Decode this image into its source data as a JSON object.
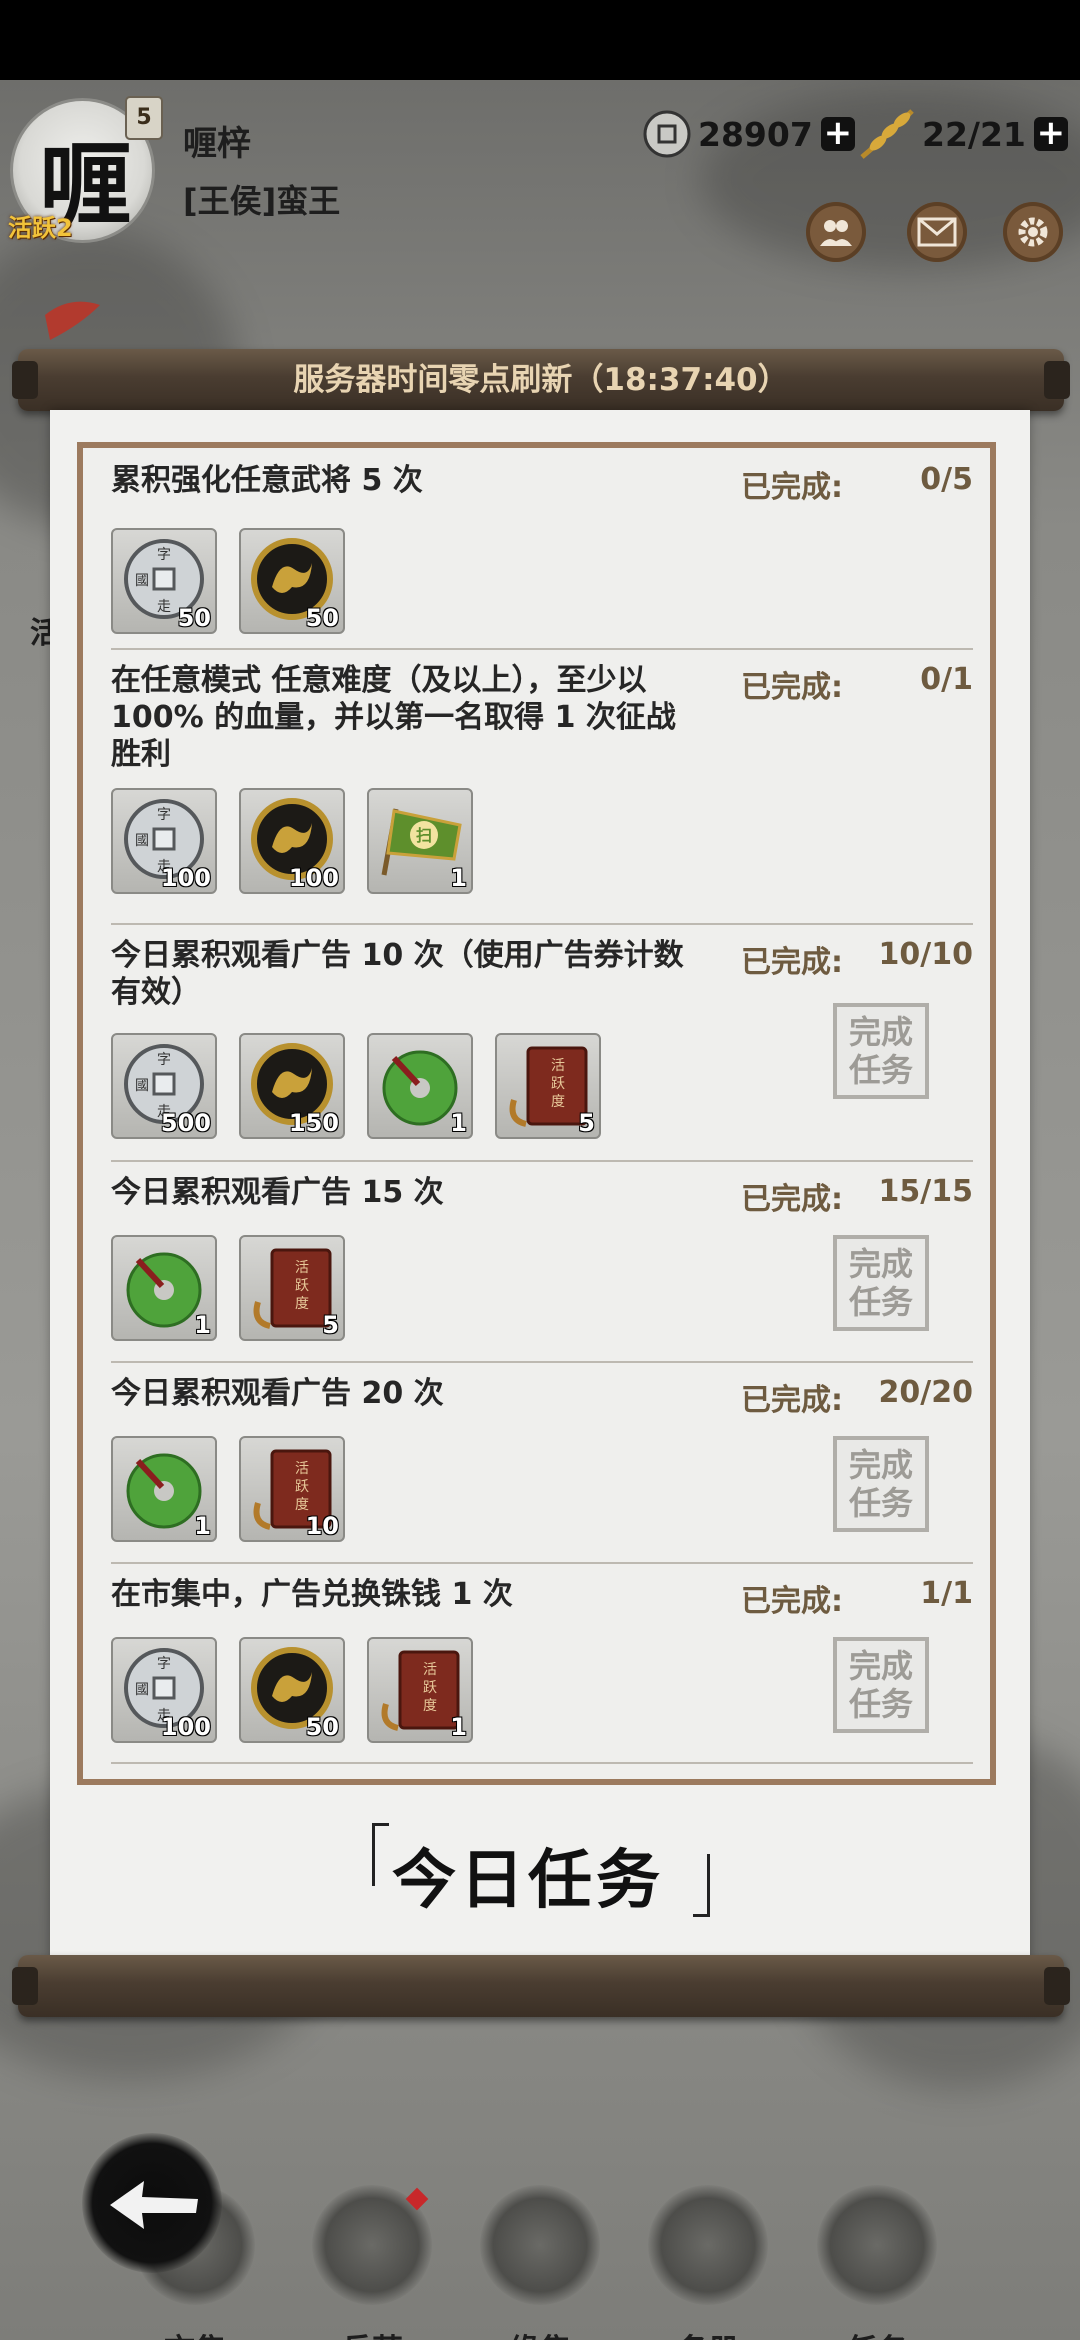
{
  "player": {
    "avatar_char": "喱",
    "level": "5",
    "active_tag": "活跃2",
    "name": "喱梓",
    "title": "[王侯]蛮王"
  },
  "resources": {
    "coins": "28907",
    "grain": "22/21"
  },
  "header_icons": [
    "friends-icon",
    "mail-icon",
    "settings-icon"
  ],
  "left_label": "活",
  "banner": "服务器时间零点刷新（18:37:40）",
  "tasks": [
    {
      "title": "累积强化任意武将 5 次",
      "done_label": "已完成:",
      "progress": "0/5",
      "rewards": [
        {
          "icon": "copper-coin",
          "count": "50"
        },
        {
          "icon": "gold-dragon-coin",
          "count": "50"
        }
      ]
    },
    {
      "title": "在任意模式 任意难度（及以上），至少以 100% 的血量，并以第一名取得 1 次征战胜利",
      "done_label": "已完成:",
      "progress": "0/1",
      "rewards": [
        {
          "icon": "copper-coin",
          "count": "100"
        },
        {
          "icon": "gold-dragon-coin",
          "count": "100"
        },
        {
          "icon": "green-flag",
          "count": "1"
        }
      ]
    },
    {
      "title": "今日累积观看广告 10 次（使用广告券计数有效）",
      "done_label": "已完成:",
      "progress": "10/10",
      "stamp": "完成任务",
      "rewards": [
        {
          "icon": "copper-coin",
          "count": "500"
        },
        {
          "icon": "gold-dragon-coin",
          "count": "150"
        },
        {
          "icon": "jade-disc",
          "count": "1"
        },
        {
          "icon": "activity-book",
          "count": "5"
        }
      ]
    },
    {
      "title": "今日累积观看广告 15 次",
      "done_label": "已完成:",
      "progress": "15/15",
      "stamp": "完成任务",
      "rewards": [
        {
          "icon": "jade-disc",
          "count": "1"
        },
        {
          "icon": "activity-book",
          "count": "5"
        }
      ]
    },
    {
      "title": "今日累积观看广告 20 次",
      "done_label": "已完成:",
      "progress": "20/20",
      "stamp": "完成任务",
      "rewards": [
        {
          "icon": "jade-disc",
          "count": "1"
        },
        {
          "icon": "activity-book",
          "count": "10"
        }
      ]
    },
    {
      "title": "在市集中，广告兑换铢钱 1 次",
      "done_label": "已完成:",
      "progress": "1/1",
      "stamp": "完成任务",
      "rewards": [
        {
          "icon": "copper-coin",
          "count": "100"
        },
        {
          "icon": "gold-dragon-coin",
          "count": "50"
        },
        {
          "icon": "activity-book",
          "count": "1"
        }
      ]
    }
  ],
  "scroll_title": "今日任务",
  "nav": [
    {
      "label": "市集",
      "icon": "market-icon"
    },
    {
      "label": "兵营",
      "icon": "barracks-icon"
    },
    {
      "label": "缘集",
      "icon": "fate-icon"
    },
    {
      "label": "名册",
      "icon": "roster-icon"
    },
    {
      "label": "任务",
      "icon": "task-icon"
    }
  ],
  "colors": {
    "paper": "#efefed",
    "frame": "#9c7a5e",
    "rod": "#4a3d31",
    "text_accent": "#6e5b40"
  }
}
